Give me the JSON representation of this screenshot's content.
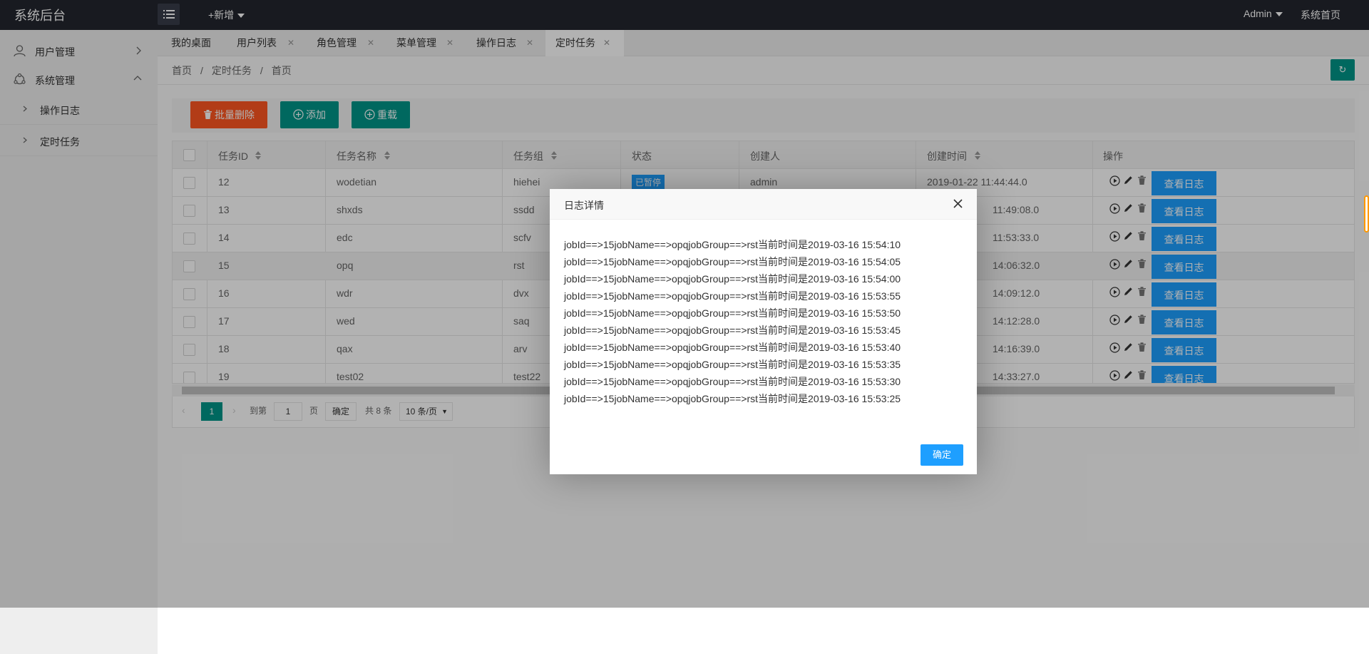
{
  "header": {
    "logo": "系统后台",
    "add_new": "+新增",
    "admin": "Admin",
    "home": "系统首页"
  },
  "sidebar": {
    "items": [
      {
        "label": "用户管理"
      },
      {
        "label": "系统管理"
      }
    ],
    "subitems": [
      {
        "label": "操作日志"
      },
      {
        "label": "定时任务"
      }
    ]
  },
  "tabs": [
    {
      "label": "我的桌面"
    },
    {
      "label": "用户列表"
    },
    {
      "label": "角色管理"
    },
    {
      "label": "菜单管理"
    },
    {
      "label": "操作日志"
    },
    {
      "label": "定时任务"
    }
  ],
  "breadcrumb": [
    "首页",
    "/",
    "定时任务",
    "/",
    "首页"
  ],
  "toolbar": {
    "batch_delete": "批量删除",
    "add": "添加",
    "reload": "重载"
  },
  "table": {
    "headers": [
      "任务ID",
      "任务名称",
      "任务组",
      "状态",
      "创建人",
      "创建时间",
      "操作"
    ],
    "view_log_label": "查看日志",
    "rows": [
      {
        "id": "12",
        "name": "wodetian",
        "group": "hiehei",
        "status": "已暂停",
        "creator": "admin",
        "time": "2019-01-22 11:44:44.0"
      },
      {
        "id": "13",
        "name": "shxds",
        "group": "ssdd",
        "status": "",
        "creator": "",
        "time": "11:49:08.0"
      },
      {
        "id": "14",
        "name": "edc",
        "group": "scfv",
        "status": "",
        "creator": "",
        "time": "11:53:33.0"
      },
      {
        "id": "15",
        "name": "opq",
        "group": "rst",
        "status": "",
        "creator": "",
        "time": "14:06:32.0"
      },
      {
        "id": "16",
        "name": "wdr",
        "group": "dvx",
        "status": "",
        "creator": "",
        "time": "14:09:12.0"
      },
      {
        "id": "17",
        "name": "wed",
        "group": "saq",
        "status": "",
        "creator": "",
        "time": "14:12:28.0"
      },
      {
        "id": "18",
        "name": "qax",
        "group": "arv",
        "status": "",
        "creator": "",
        "time": "14:16:39.0"
      },
      {
        "id": "19",
        "name": "test02",
        "group": "test22",
        "status": "",
        "creator": "",
        "time": "14:33:27.0"
      }
    ]
  },
  "pager": {
    "current": "1",
    "goto": "到第",
    "page_input": "1",
    "page_unit": "页",
    "confirm": "确定",
    "total": "共 8 条",
    "per_page": "10 条/页"
  },
  "modal": {
    "title": "日志详情",
    "lines": [
      "jobId==>15jobName==>opqjobGroup==>rst当前时间是2019-03-16 15:54:10",
      "jobId==>15jobName==>opqjobGroup==>rst当前时间是2019-03-16 15:54:05",
      "jobId==>15jobName==>opqjobGroup==>rst当前时间是2019-03-16 15:54:00",
      "jobId==>15jobName==>opqjobGroup==>rst当前时间是2019-03-16 15:53:55",
      "jobId==>15jobName==>opqjobGroup==>rst当前时间是2019-03-16 15:53:50",
      "jobId==>15jobName==>opqjobGroup==>rst当前时间是2019-03-16 15:53:45",
      "jobId==>15jobName==>opqjobGroup==>rst当前时间是2019-03-16 15:53:40",
      "jobId==>15jobName==>opqjobGroup==>rst当前时间是2019-03-16 15:53:35",
      "jobId==>15jobName==>opqjobGroup==>rst当前时间是2019-03-16 15:53:30",
      "jobId==>15jobName==>opqjobGroup==>rst当前时间是2019-03-16 15:53:25"
    ],
    "ok": "确定"
  },
  "colors": {
    "header_bg": "#23262e",
    "accent_green": "#009688",
    "danger_orange": "#ff5722",
    "info_blue": "#1e9fff"
  }
}
